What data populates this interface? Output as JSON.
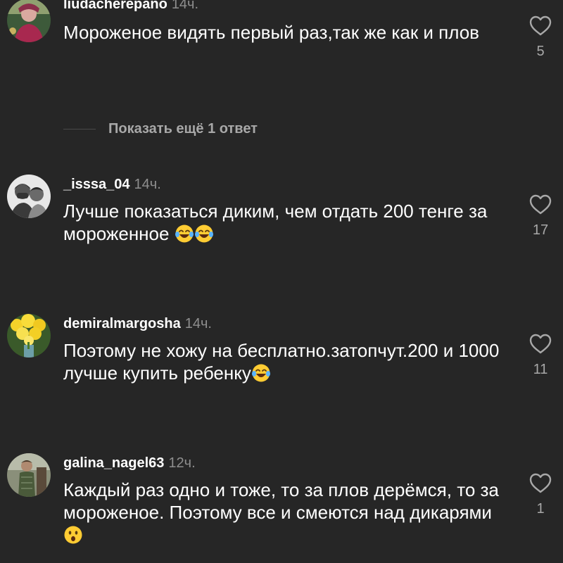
{
  "comments": [
    {
      "username": "liudacherepano",
      "time": "14ч.",
      "text": "Мороженое видять первый раз,так же как и плов",
      "emojis": [],
      "likes": "5",
      "avatar_icon": "avatar-photo-icon"
    },
    {
      "username": "_isssa_04",
      "time": "14ч.",
      "text": "Лучше показаться диким, чем отдать 200 тенге за мороженное ",
      "emojis": [
        "😂",
        "😂"
      ],
      "likes": "17",
      "avatar_icon": "avatar-photo-icon"
    },
    {
      "username": "demiralmargosha",
      "time": "14ч.",
      "text": "Поэтому не хожу на бесплатно.затопчут.200 и 1000 лучше купить ребенку",
      "emojis": [
        "😂"
      ],
      "likes": "11",
      "avatar_icon": "avatar-photo-icon"
    },
    {
      "username": "galina_nagel63",
      "time": "12ч.",
      "text": "Каждый раз одно и тоже,  то за плов дерёмся, то за мороженое. Поэтому все и смеются над дикарями ",
      "emojis": [
        "😯"
      ],
      "likes": "1",
      "avatar_icon": "avatar-photo-icon"
    }
  ],
  "replies_toggle": {
    "label": "Показать ещё 1 ответ"
  },
  "colors": {
    "background": "#262626",
    "text": "#ffffff",
    "secondary": "#8e8e8e",
    "emoji_yellow": "#ffcc33"
  },
  "icons": {
    "like": "heart-outline-icon",
    "laugh_emoji": "face-with-tears-of-joy-icon",
    "surprised_emoji": "hushed-face-icon"
  }
}
